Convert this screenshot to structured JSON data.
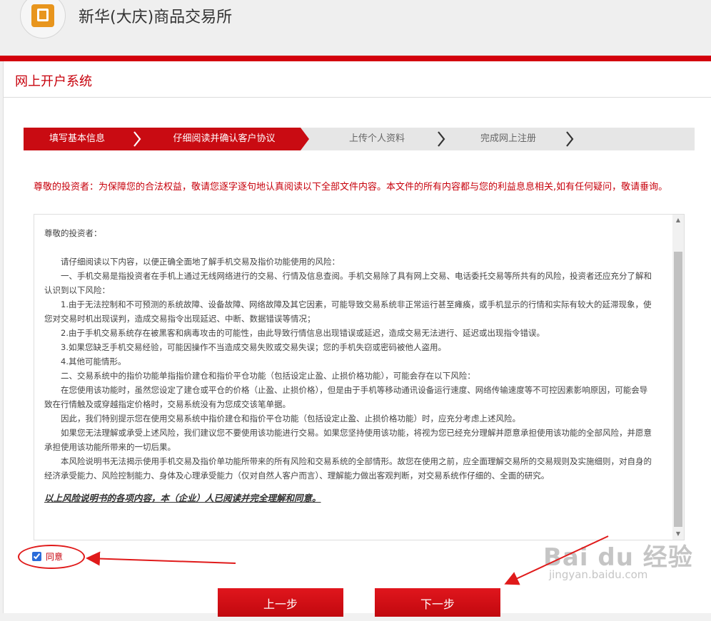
{
  "header": {
    "site_title": "新华(大庆)商品交易所",
    "logo_icon": "company-logo-icon"
  },
  "system": {
    "title": "网上开户系统"
  },
  "steps": [
    {
      "label": "填写基本信息",
      "active": true
    },
    {
      "label": "仔细阅读并确认客户协议",
      "active": true
    },
    {
      "label": "上传个人资料",
      "active": false
    },
    {
      "label": "完成网上注册",
      "active": false
    }
  ],
  "notice": "尊敬的投资者：为保障您的合法权益，敬请您逐字逐句地认真阅读以下全部文件内容。本文件的所有内容都与您的利益息息相关,如有任何疑问，敬请垂询。",
  "document": {
    "salutation": "尊敬的投资者：",
    "paragraphs": [
      "请仔细阅读以下内容，以便正确全面地了解手机交易及指价功能使用的风险：",
      "一、手机交易是指投资者在手机上通过无线网络进行的交易、行情及信息查阅。手机交易除了具有网上交易、电话委托交易等所共有的风险，投资者还应充分了解和认识到以下风险：",
      "1.由于无法控制和不可预测的系统故障、设备故障、网络故障及其它因素，可能导致交易系统非正常运行甚至瘫痪，或手机显示的行情和实际有较大的延滞现象，使您对交易时机出现误判，造成交易指令出现延迟、中断、数据错误等情况；",
      "2.由于手机交易系统存在被黑客和病毒攻击的可能性，由此导致行情信息出现错误或延迟，造成交易无法进行、延迟或出现指令错误。",
      "3.如果您缺乏手机交易经验，可能因操作不当造成交易失败或交易失误；您的手机失窃或密码被他人盗用。",
      "4.其他可能情形。",
      "二、交易系统中的指价功能单指指价建仓和指价平仓功能（包括设定止盈、止损价格功能），可能会存在以下风险：",
      "在您使用该功能时，虽然您设定了建仓或平仓的价格（止盈、止损价格），但是由于手机等移动通讯设备运行速度、网络传输速度等不可控因素影响原因，可能会导致在行情触及或穿越指定价格时，交易系统没有为您成交该笔单据。",
      "因此，我们特别提示您在使用交易系统中指价建仓和指价平仓功能（包括设定止盈、止损价格功能）时，应充分考虑上述风险。",
      "如果您无法理解或承受上述风险，我们建议您不要使用该功能进行交易。如果您坚持使用该功能，将视为您已经充分理解并愿意承担使用该功能的全部风险，并愿意承担使用该功能所带来的一切后果。",
      "本风险说明书无法揭示使用手机交易及指价单功能所带来的所有风险和交易系统的全部情形。故您在使用之前，应全面理解交易所的交易规则及实施细则，对自身的经济承受能力、风险控制能力、身体及心理承受能力（仅对自然人客户而言）、理解能力做出客观判断，对交易系统作仔细的、全面的研究。"
    ],
    "final_statement": "以上风险说明书的各项内容，本（企业）人已阅读并完全理解和同意。"
  },
  "agree": {
    "label": "同意",
    "checked": true
  },
  "buttons": {
    "prev_label": "上一步",
    "next_label": "下一步"
  },
  "watermark": {
    "main": "Bai du 经验",
    "sub": "jingyan.baidu.com"
  },
  "colors": {
    "brand_red": "#c90b12",
    "header_bar": "#d3000d",
    "notice_text": "#c7000b",
    "annotation_red": "#e01a1a"
  }
}
